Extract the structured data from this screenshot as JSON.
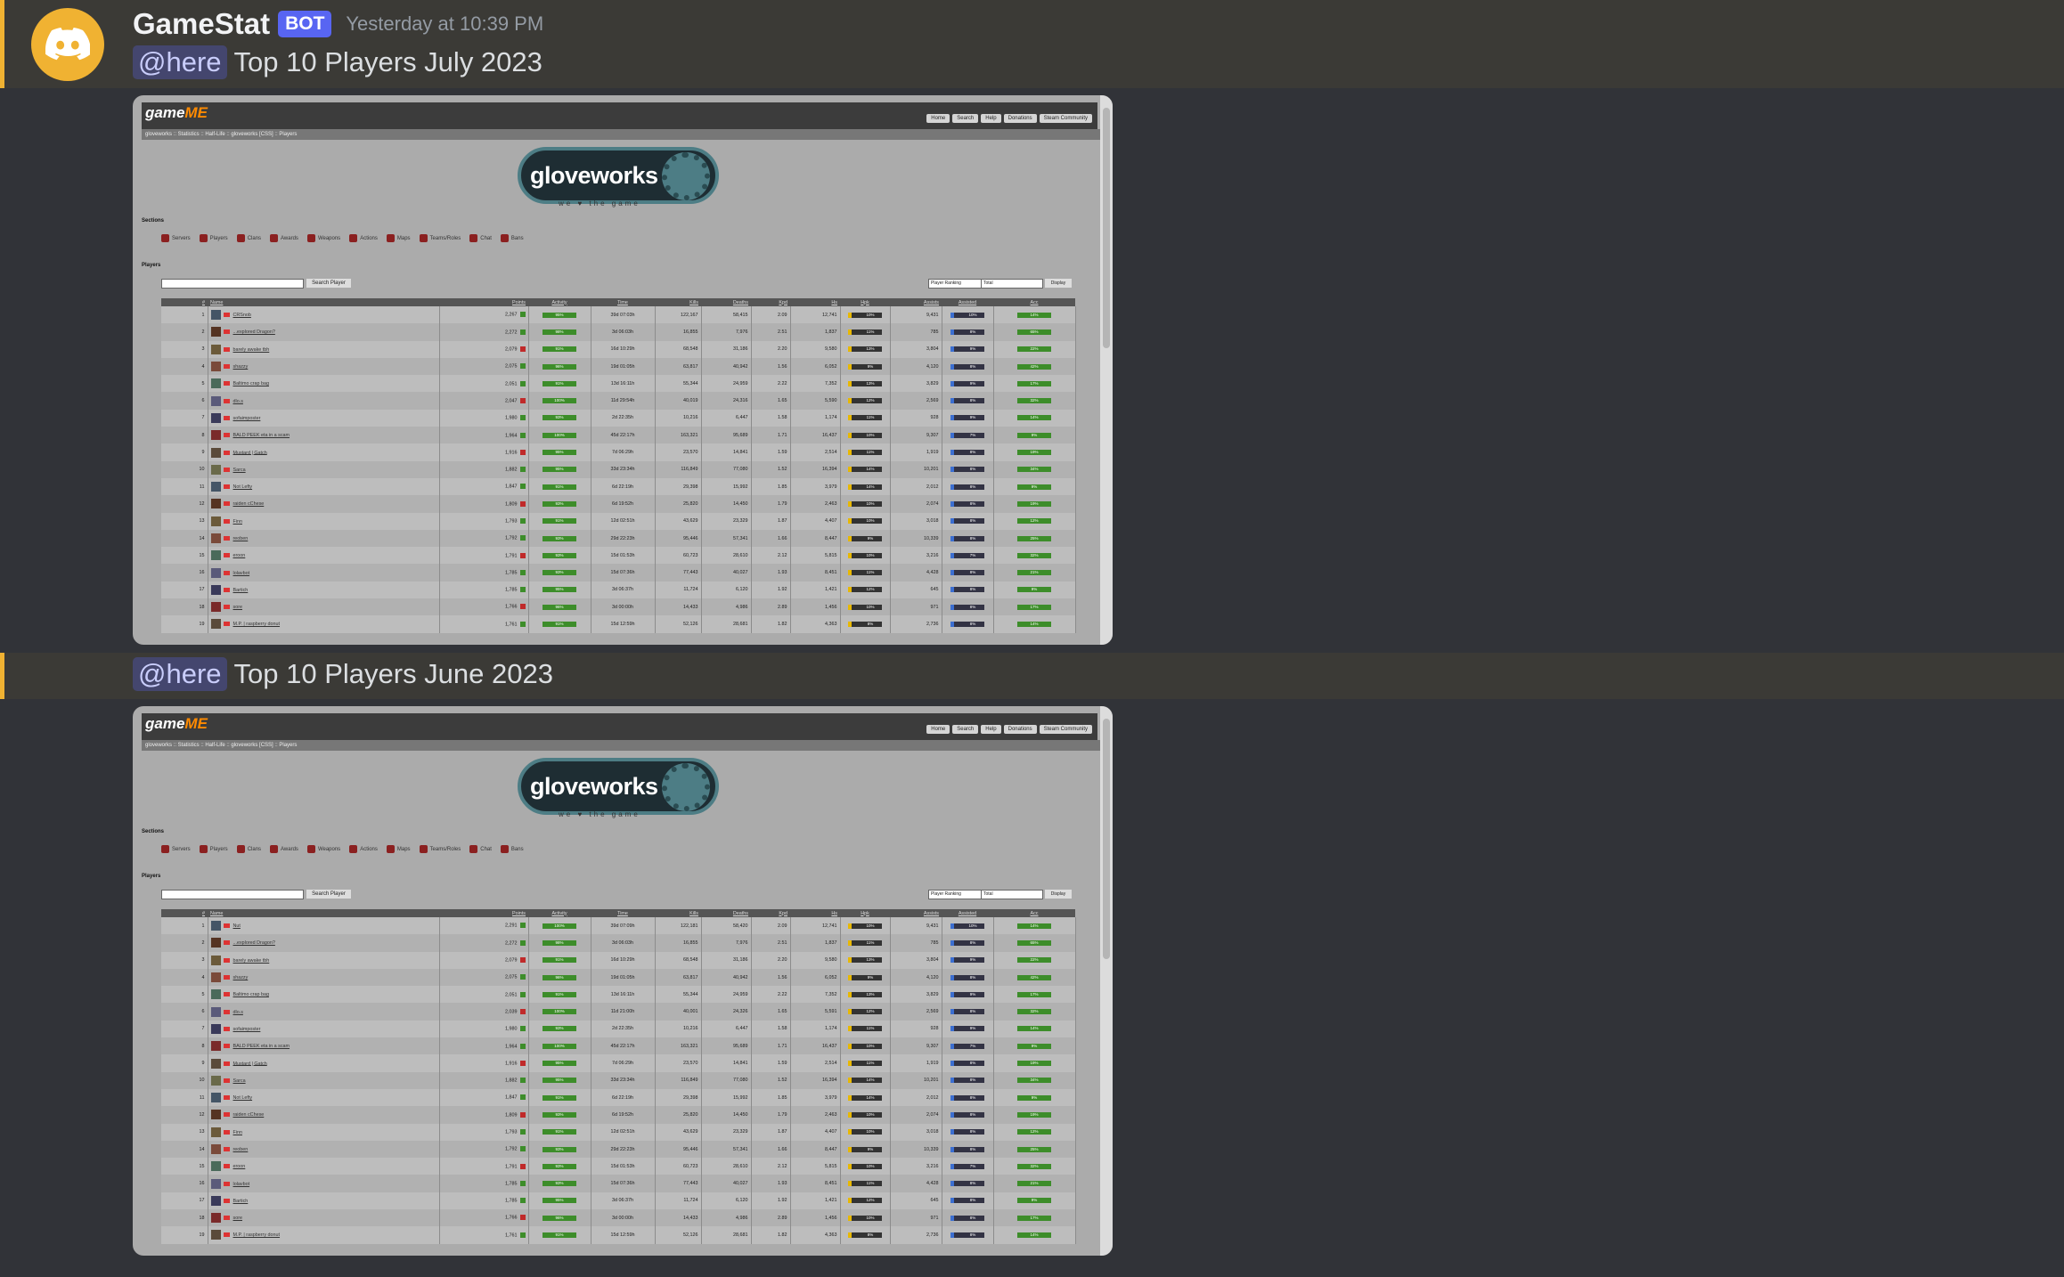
{
  "message1": {
    "author": "GameStat",
    "badge": "BOT",
    "timestamp": "Yesterday at 10:39 PM",
    "mention": "@here",
    "text": "Top 10 Players July 2023"
  },
  "message2": {
    "mention": "@here",
    "text": "Top 10 Players June 2023"
  },
  "site": {
    "logo_main": "game",
    "logo_accent": "ME",
    "nav": [
      "Home",
      "Search",
      "Help",
      "Donations",
      "Steam Community"
    ],
    "breadcrumb": "gloveworks :: Statistics :: Half-Life :: gloveworks [CSS] :: Players",
    "banner_title": "gloveworks",
    "tagline": "we ♥ the game",
    "sections_label": "Sections",
    "section_links": [
      "Servers",
      "Players",
      "Clans",
      "Awards",
      "Weapons",
      "Actions",
      "Maps",
      "Teams/Roles",
      "Chat",
      "Bans"
    ],
    "players_label": "Players",
    "search_button": "Search Player",
    "ranking_select": "Player Ranking",
    "period_select": "Total",
    "display_button": "Display",
    "columns": [
      "#",
      "Name",
      "Points",
      "Activity",
      "Time",
      "Kills",
      "Deaths",
      "Kpd",
      "Hs",
      "Hpk",
      "Assists",
      "Assisted",
      "Acc"
    ]
  },
  "table_july": [
    {
      "rank": "1",
      "name": "CRSnob",
      "points": "2,267",
      "activity": "95%",
      "time": "39d 07:03h",
      "kills": "122,167",
      "deaths": "58,415",
      "kpd": "2.09",
      "hs": "12,741",
      "hpk": "10%",
      "assists": "9,431",
      "assisted": "10%",
      "acc": "14%"
    },
    {
      "rank": "2",
      "name": "...explored Dragon?",
      "points": "2,272",
      "activity": "98%",
      "time": "3d 06:03h",
      "kills": "16,855",
      "deaths": "7,976",
      "kpd": "2.51",
      "hs": "1,837",
      "hpk": "11%",
      "assists": "785",
      "assisted": "8%",
      "acc": "65%"
    },
    {
      "rank": "3",
      "name": "barely awake tbh",
      "points": "2,079",
      "activity": "91%",
      "time": "16d 10:29h",
      "kills": "68,548",
      "deaths": "31,186",
      "kpd": "2.20",
      "hs": "9,580",
      "hpk": "13%",
      "assists": "3,804",
      "assisted": "9%",
      "acc": "22%"
    },
    {
      "rank": "4",
      "name": "shazzy",
      "points": "2,075",
      "activity": "96%",
      "time": "19d 01:05h",
      "kills": "63,817",
      "deaths": "40,942",
      "kpd": "1.56",
      "hs": "6,052",
      "hpk": "9%",
      "assists": "4,120",
      "assisted": "8%",
      "acc": "42%"
    },
    {
      "rank": "5",
      "name": "Baltimo crap bag",
      "points": "2,051",
      "activity": "91%",
      "time": "13d 16:11h",
      "kills": "55,344",
      "deaths": "24,959",
      "kpd": "2.22",
      "hs": "7,352",
      "hpk": "13%",
      "assists": "3,829",
      "assisted": "9%",
      "acc": "17%"
    },
    {
      "rank": "6",
      "name": "dlo.s",
      "points": "2,047",
      "activity": "100%",
      "time": "11d 29:54h",
      "kills": "40,019",
      "deaths": "24,316",
      "kpd": "1.65",
      "hs": "5,590",
      "hpk": "12%",
      "assists": "2,569",
      "assisted": "8%",
      "acc": "32%"
    },
    {
      "rank": "7",
      "name": "sofaimposter",
      "points": "1,980",
      "activity": "93%",
      "time": "2d 22:35h",
      "kills": "10,216",
      "deaths": "6,447",
      "kpd": "1.58",
      "hs": "1,174",
      "hpk": "11%",
      "assists": "928",
      "assisted": "9%",
      "acc": "14%"
    },
    {
      "rank": "8",
      "name": "BALD PEEK eta in a scam",
      "points": "1,964",
      "activity": "100%",
      "time": "45d 22:17h",
      "kills": "163,321",
      "deaths": "95,689",
      "kpd": "1.71",
      "hs": "16,437",
      "hpk": "10%",
      "assists": "9,307",
      "assisted": "7%",
      "acc": "9%"
    },
    {
      "rank": "9",
      "name": "Mustard | Gatch",
      "points": "1,916",
      "activity": "95%",
      "time": "7d 06:29h",
      "kills": "23,570",
      "deaths": "14,841",
      "kpd": "1.59",
      "hs": "2,514",
      "hpk": "11%",
      "assists": "1,919",
      "assisted": "8%",
      "acc": "19%"
    },
    {
      "rank": "10",
      "name": "Sarca",
      "points": "1,882",
      "activity": "95%",
      "time": "33d 23:34h",
      "kills": "116,849",
      "deaths": "77,080",
      "kpd": "1.52",
      "hs": "16,394",
      "hpk": "14%",
      "assists": "10,201",
      "assisted": "8%",
      "acc": "34%"
    },
    {
      "rank": "11",
      "name": "Not Lefty",
      "points": "1,847",
      "activity": "91%",
      "time": "6d 22:19h",
      "kills": "29,398",
      "deaths": "15,992",
      "kpd": "1.85",
      "hs": "3,979",
      "hpk": "14%",
      "assists": "2,012",
      "assisted": "8%",
      "acc": "9%"
    },
    {
      "rank": "12",
      "name": "raiden cChese",
      "points": "1,809",
      "activity": "93%",
      "time": "6d 19:52h",
      "kills": "25,820",
      "deaths": "14,450",
      "kpd": "1.79",
      "hs": "2,463",
      "hpk": "10%",
      "assists": "2,074",
      "assisted": "8%",
      "acc": "19%"
    },
    {
      "rank": "13",
      "name": "Finn",
      "points": "1,793",
      "activity": "91%",
      "time": "12d 02:51h",
      "kills": "43,629",
      "deaths": "23,329",
      "kpd": "1.87",
      "hs": "4,407",
      "hpk": "10%",
      "assists": "3,018",
      "assisted": "8%",
      "acc": "12%"
    },
    {
      "rank": "14",
      "name": "reoben",
      "points": "1,792",
      "activity": "93%",
      "time": "29d 22:23h",
      "kills": "95,446",
      "deaths": "57,341",
      "kpd": "1.66",
      "hs": "8,447",
      "hpk": "9%",
      "assists": "10,339",
      "assisted": "8%",
      "acc": "25%"
    },
    {
      "rank": "15",
      "name": "eroon",
      "points": "1,791",
      "activity": "93%",
      "time": "15d 01:53h",
      "kills": "60,723",
      "deaths": "28,610",
      "kpd": "2.12",
      "hs": "5,815",
      "hpk": "10%",
      "assists": "3,216",
      "assisted": "7%",
      "acc": "32%"
    },
    {
      "rank": "16",
      "name": "lolavbot",
      "points": "1,785",
      "activity": "93%",
      "time": "15d 07:36h",
      "kills": "77,443",
      "deaths": "40,027",
      "kpd": "1.93",
      "hs": "8,451",
      "hpk": "11%",
      "assists": "4,428",
      "assisted": "8%",
      "acc": "21%"
    },
    {
      "rank": "17",
      "name": "Bartich",
      "points": "1,785",
      "activity": "95%",
      "time": "3d 06:37h",
      "kills": "11,724",
      "deaths": "6,120",
      "kpd": "1.92",
      "hs": "1,421",
      "hpk": "12%",
      "assists": "645",
      "assisted": "8%",
      "acc": "9%"
    },
    {
      "rank": "18",
      "name": "sore",
      "points": "1,766",
      "activity": "96%",
      "time": "3d 00:00h",
      "kills": "14,433",
      "deaths": "4,986",
      "kpd": "2.89",
      "hs": "1,456",
      "hpk": "10%",
      "assists": "971",
      "assisted": "8%",
      "acc": "17%"
    },
    {
      "rank": "19",
      "name": "M.P. | raspberry donut",
      "points": "1,761",
      "activity": "91%",
      "time": "15d 12:59h",
      "kills": "52,126",
      "deaths": "28,681",
      "kpd": "1.82",
      "hs": "4,363",
      "hpk": "8%",
      "assists": "2,736",
      "assisted": "8%",
      "acc": "14%"
    }
  ],
  "table_june": [
    {
      "rank": "1",
      "name": "Nut",
      "points": "2,291",
      "activity": "100%",
      "time": "39d 07:09h",
      "kills": "122,181",
      "deaths": "58,420",
      "kpd": "2.09",
      "hs": "12,741",
      "hpk": "10%",
      "assists": "9,431",
      "assisted": "10%",
      "acc": "14%"
    },
    {
      "rank": "2",
      "name": "...explored Dragon?",
      "points": "2,272",
      "activity": "98%",
      "time": "3d 06:03h",
      "kills": "16,855",
      "deaths": "7,976",
      "kpd": "2.51",
      "hs": "1,837",
      "hpk": "11%",
      "assists": "785",
      "assisted": "8%",
      "acc": "65%"
    },
    {
      "rank": "3",
      "name": "barely awake tbh",
      "points": "2,079",
      "activity": "91%",
      "time": "16d 10:29h",
      "kills": "68,548",
      "deaths": "31,186",
      "kpd": "2.20",
      "hs": "9,580",
      "hpk": "13%",
      "assists": "3,804",
      "assisted": "9%",
      "acc": "22%"
    },
    {
      "rank": "4",
      "name": "shazzy",
      "points": "2,075",
      "activity": "96%",
      "time": "19d 01:05h",
      "kills": "63,817",
      "deaths": "40,942",
      "kpd": "1.56",
      "hs": "6,052",
      "hpk": "9%",
      "assists": "4,120",
      "assisted": "8%",
      "acc": "42%"
    },
    {
      "rank": "5",
      "name": "Baltimo crap bag",
      "points": "2,051",
      "activity": "91%",
      "time": "13d 16:11h",
      "kills": "55,344",
      "deaths": "24,959",
      "kpd": "2.22",
      "hs": "7,352",
      "hpk": "13%",
      "assists": "3,829",
      "assisted": "9%",
      "acc": "17%"
    },
    {
      "rank": "6",
      "name": "dlo.s",
      "points": "2,039",
      "activity": "100%",
      "time": "11d 21:00h",
      "kills": "40,001",
      "deaths": "24,326",
      "kpd": "1.65",
      "hs": "5,591",
      "hpk": "12%",
      "assists": "2,569",
      "assisted": "8%",
      "acc": "32%"
    },
    {
      "rank": "7",
      "name": "sofaimposter",
      "points": "1,980",
      "activity": "93%",
      "time": "2d 22:35h",
      "kills": "10,216",
      "deaths": "6,447",
      "kpd": "1.58",
      "hs": "1,174",
      "hpk": "11%",
      "assists": "928",
      "assisted": "9%",
      "acc": "14%"
    },
    {
      "rank": "8",
      "name": "BALD PEEK eta in a scam",
      "points": "1,964",
      "activity": "100%",
      "time": "45d 22:17h",
      "kills": "163,321",
      "deaths": "95,689",
      "kpd": "1.71",
      "hs": "16,437",
      "hpk": "10%",
      "assists": "9,307",
      "assisted": "7%",
      "acc": "9%"
    },
    {
      "rank": "9",
      "name": "Mustard | Gatch",
      "points": "1,916",
      "activity": "95%",
      "time": "7d 06:29h",
      "kills": "23,570",
      "deaths": "14,841",
      "kpd": "1.59",
      "hs": "2,514",
      "hpk": "11%",
      "assists": "1,919",
      "assisted": "8%",
      "acc": "19%"
    },
    {
      "rank": "10",
      "name": "Sarca",
      "points": "1,882",
      "activity": "95%",
      "time": "33d 23:34h",
      "kills": "116,849",
      "deaths": "77,080",
      "kpd": "1.52",
      "hs": "16,394",
      "hpk": "14%",
      "assists": "10,201",
      "assisted": "8%",
      "acc": "34%"
    },
    {
      "rank": "11",
      "name": "Not Lefty",
      "points": "1,847",
      "activity": "91%",
      "time": "6d 22:19h",
      "kills": "29,398",
      "deaths": "15,992",
      "kpd": "1.85",
      "hs": "3,979",
      "hpk": "14%",
      "assists": "2,012",
      "assisted": "8%",
      "acc": "9%"
    },
    {
      "rank": "12",
      "name": "raiden cChese",
      "points": "1,809",
      "activity": "93%",
      "time": "6d 19:52h",
      "kills": "25,820",
      "deaths": "14,450",
      "kpd": "1.79",
      "hs": "2,463",
      "hpk": "10%",
      "assists": "2,074",
      "assisted": "8%",
      "acc": "19%"
    },
    {
      "rank": "13",
      "name": "Finn",
      "points": "1,793",
      "activity": "91%",
      "time": "12d 02:51h",
      "kills": "43,629",
      "deaths": "23,329",
      "kpd": "1.87",
      "hs": "4,407",
      "hpk": "10%",
      "assists": "3,018",
      "assisted": "8%",
      "acc": "12%"
    },
    {
      "rank": "14",
      "name": "reoben",
      "points": "1,792",
      "activity": "93%",
      "time": "29d 22:23h",
      "kills": "95,446",
      "deaths": "57,341",
      "kpd": "1.66",
      "hs": "8,447",
      "hpk": "9%",
      "assists": "10,339",
      "assisted": "8%",
      "acc": "25%"
    },
    {
      "rank": "15",
      "name": "eroon",
      "points": "1,791",
      "activity": "93%",
      "time": "15d 01:53h",
      "kills": "60,723",
      "deaths": "28,610",
      "kpd": "2.12",
      "hs": "5,815",
      "hpk": "10%",
      "assists": "3,216",
      "assisted": "7%",
      "acc": "32%"
    },
    {
      "rank": "16",
      "name": "lolavbot",
      "points": "1,785",
      "activity": "93%",
      "time": "15d 07:36h",
      "kills": "77,443",
      "deaths": "40,027",
      "kpd": "1.93",
      "hs": "8,451",
      "hpk": "11%",
      "assists": "4,428",
      "assisted": "8%",
      "acc": "21%"
    },
    {
      "rank": "17",
      "name": "Bartich",
      "points": "1,785",
      "activity": "95%",
      "time": "3d 06:37h",
      "kills": "11,724",
      "deaths": "6,120",
      "kpd": "1.92",
      "hs": "1,421",
      "hpk": "12%",
      "assists": "645",
      "assisted": "8%",
      "acc": "9%"
    },
    {
      "rank": "18",
      "name": "sore",
      "points": "1,766",
      "activity": "96%",
      "time": "3d 00:00h",
      "kills": "14,433",
      "deaths": "4,986",
      "kpd": "2.89",
      "hs": "1,456",
      "hpk": "10%",
      "assists": "971",
      "assisted": "8%",
      "acc": "17%"
    },
    {
      "rank": "19",
      "name": "M.P. | raspberry donut",
      "points": "1,761",
      "activity": "91%",
      "time": "15d 12:59h",
      "kills": "52,126",
      "deaths": "28,681",
      "kpd": "1.82",
      "hs": "4,363",
      "hpk": "8%",
      "assists": "2,736",
      "assisted": "8%",
      "acc": "14%"
    }
  ]
}
